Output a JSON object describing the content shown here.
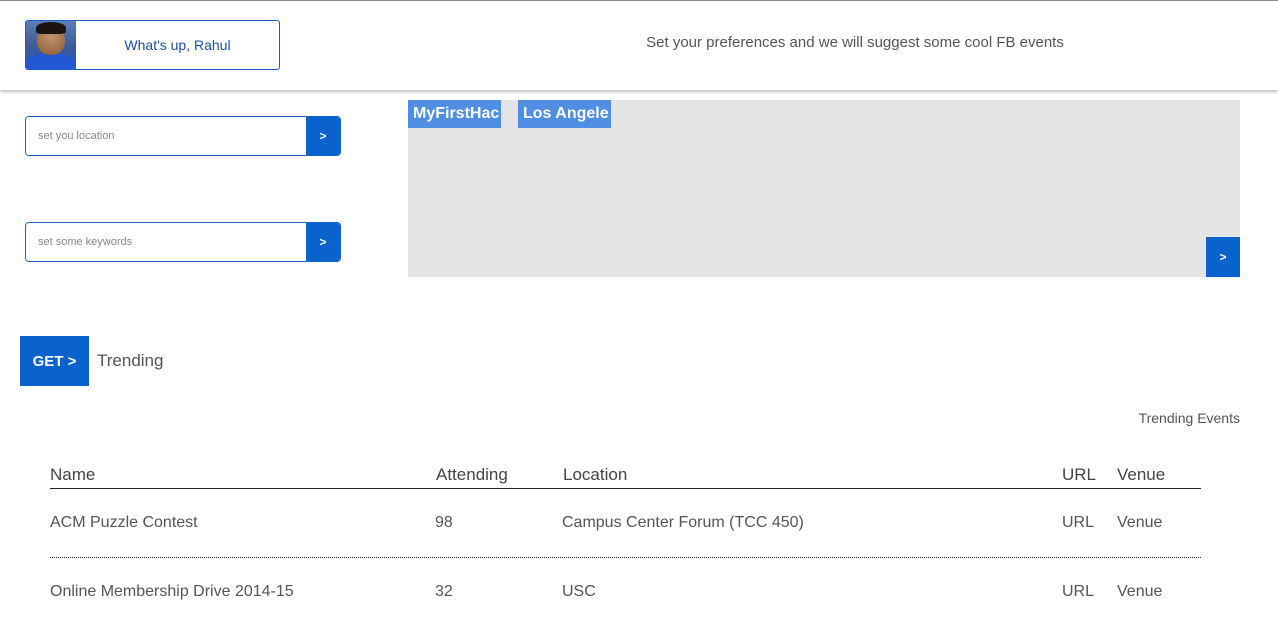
{
  "header": {
    "greeting": "What's up, Rahul",
    "tagline": "Set your preferences and we will suggest some cool FB events"
  },
  "location_input": {
    "placeholder": "set you location",
    "button": ">"
  },
  "keywords_input": {
    "placeholder": "set some keywords",
    "button": ">"
  },
  "tags": {
    "items": [
      "MyFirstHac",
      "Los Angele"
    ],
    "button": ">"
  },
  "get": {
    "button": "GET >",
    "label": "Trending"
  },
  "events": {
    "title": "Trending Events",
    "columns": [
      "Name",
      "Attending",
      "Location",
      "URL",
      "Venue"
    ],
    "rows": [
      {
        "name": "ACM Puzzle Contest",
        "attending": "98",
        "location": "Campus Center Forum (TCC 450)",
        "url": "URL",
        "venue": "Venue"
      },
      {
        "name": "Online Membership Drive 2014-15",
        "attending": "32",
        "location": "USC",
        "url": "URL",
        "venue": "Venue"
      }
    ]
  },
  "colors": {
    "accent": "#0a62cc",
    "tag": "#4f8ee0",
    "panel": "#e4e4e4"
  }
}
